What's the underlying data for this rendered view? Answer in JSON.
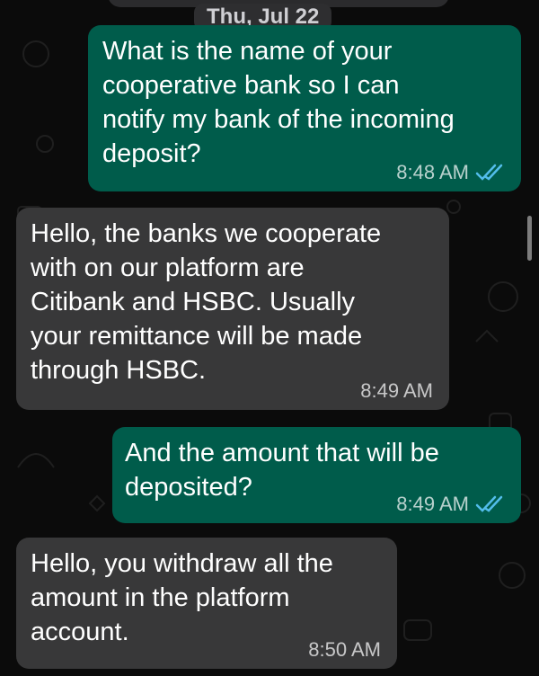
{
  "chat": {
    "date_separator": "Thu, Jul 22",
    "messages": [
      {
        "direction": "outgoing",
        "text": "What is the name of your\ncooperative bank so I can\nnotify my bank of the incoming\ndeposit?",
        "time": "8:48 AM",
        "status_icon": "double-check-read-icon"
      },
      {
        "direction": "incoming",
        "text": "Hello, the banks we cooperate\nwith on our platform are\nCitibank and HSBC. Usually\nyour remittance will be made\nthrough HSBC.",
        "time": "8:49 AM"
      },
      {
        "direction": "outgoing",
        "text": "And the amount that will be\ndeposited?",
        "time": "8:49 AM",
        "status_icon": "double-check-read-icon"
      },
      {
        "direction": "incoming",
        "text": "Hello, you withdraw all the\namount in the platform\naccount.",
        "time": "8:50 AM"
      }
    ]
  },
  "colors": {
    "background": "#0b0b0b",
    "outgoing_bubble": "#005c4b",
    "incoming_bubble": "#383839",
    "read_receipt": "#53bdeb"
  }
}
